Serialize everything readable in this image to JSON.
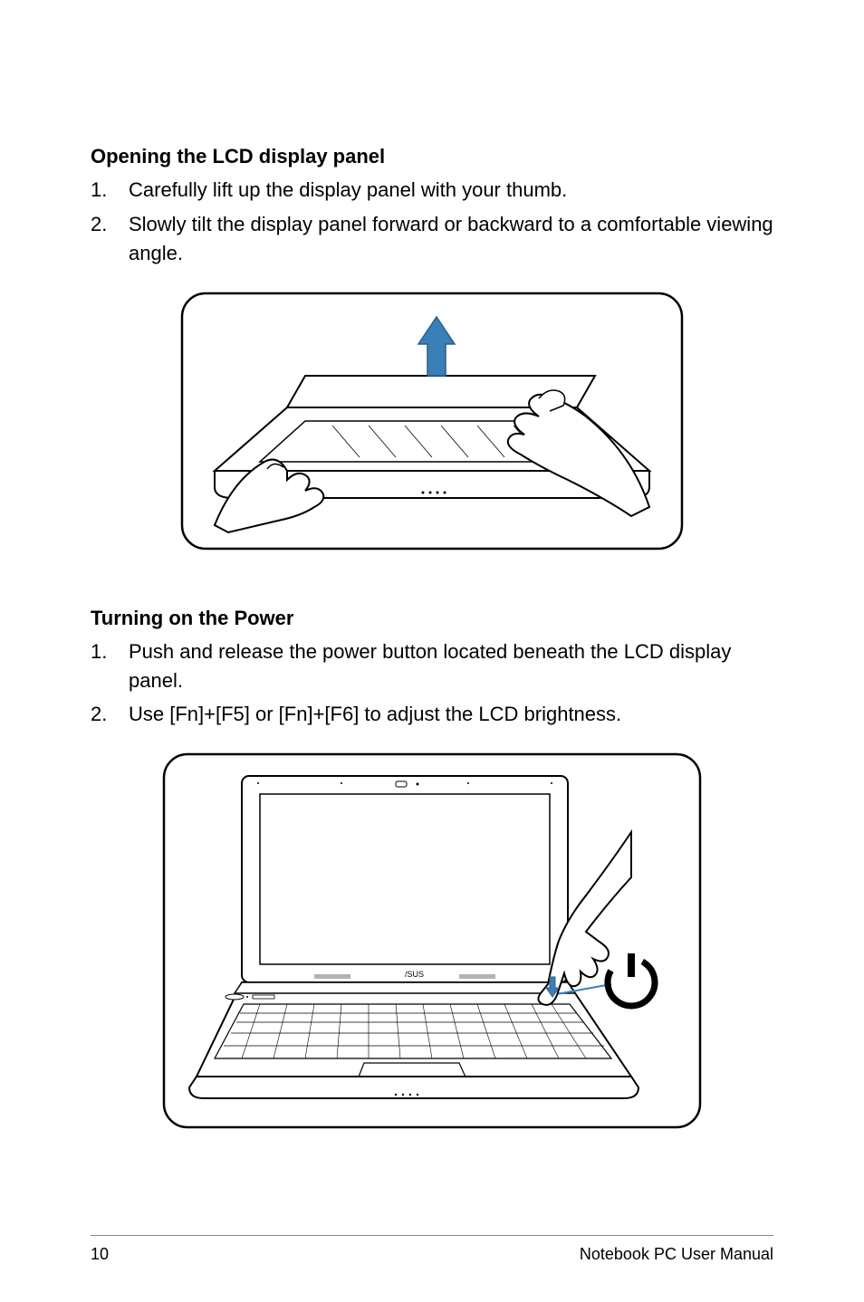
{
  "section1": {
    "title": "Opening the LCD display panel",
    "items": [
      {
        "num": "1.",
        "text": "Carefully lift up the display panel with your thumb."
      },
      {
        "num": "2.",
        "text": "Slowly tilt the display panel forward or backward to a comfortable viewing angle."
      }
    ]
  },
  "section2": {
    "title": "Turning on the Power",
    "items": [
      {
        "num": "1.",
        "text": "Push and release the power button located beneath the LCD display panel."
      },
      {
        "num": "2.",
        "text": "Use [Fn]+[F5] or [Fn]+[F6] to adjust the LCD brightness."
      }
    ]
  },
  "footer": {
    "page": "10",
    "doc": "Notebook PC User Manual"
  }
}
